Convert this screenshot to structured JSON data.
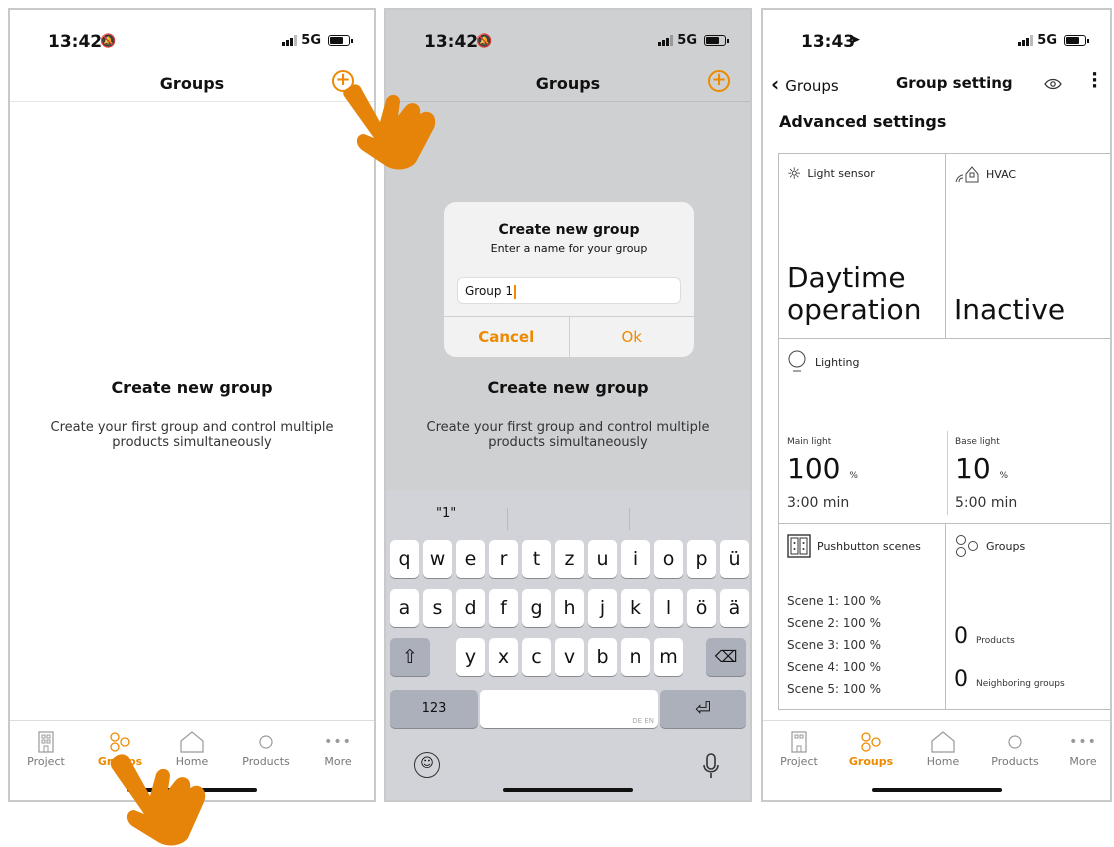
{
  "status": {
    "time_1": "13:42",
    "time_2": "13:42",
    "time_3": "13:43",
    "network": "5G"
  },
  "screen1": {
    "title": "Groups",
    "empty_title": "Create new group",
    "empty_text": "Create your first group and control multiple products simultaneously"
  },
  "screen2": {
    "title": "Groups",
    "dialog": {
      "title": "Create new group",
      "subtitle": "Enter a name for your group",
      "input_value": "Group 1",
      "cancel_label": "Cancel",
      "ok_label": "Ok"
    },
    "empty_title": "Create new group",
    "empty_text": "Create your first group and control multiple products simultaneously",
    "keyboard": {
      "suggestion": "\"1\"",
      "row1": [
        "q",
        "w",
        "e",
        "r",
        "t",
        "z",
        "u",
        "i",
        "o",
        "p",
        "ü"
      ],
      "row2": [
        "a",
        "s",
        "d",
        "f",
        "g",
        "h",
        "j",
        "k",
        "l",
        "ö",
        "ä"
      ],
      "row3": [
        "y",
        "x",
        "c",
        "v",
        "b",
        "n",
        "m"
      ],
      "numbers_label": "123",
      "space_hint": "DE EN"
    }
  },
  "screen3": {
    "back_label": "Groups",
    "title": "Group setting",
    "section": "Advanced settings",
    "light_sensor": {
      "label": "Light sensor",
      "value": "Daytime operation"
    },
    "hvac": {
      "label": "HVAC",
      "value": "Inactive"
    },
    "lighting": {
      "label": "Lighting",
      "main_label": "Main light",
      "main_value": "100",
      "main_unit": "%",
      "main_time": "3:00 min",
      "base_label": "Base light",
      "base_value": "10",
      "base_unit": "%",
      "base_time": "5:00 min"
    },
    "pushbutton": {
      "label": "Pushbutton scenes",
      "scenes": [
        "Scene 1: 100 %",
        "Scene 2: 100 %",
        "Scene 3: 100 %",
        "Scene 4: 100 %",
        "Scene 5: 100 %"
      ]
    },
    "groups_card": {
      "label": "Groups",
      "products_value": "0",
      "products_label": "Products",
      "neighbor_value": "0",
      "neighbor_label": "Neighboring groups"
    }
  },
  "tabbar": {
    "items": [
      {
        "label": "Project",
        "icon": "building-icon"
      },
      {
        "label": "Groups",
        "icon": "groups-icon"
      },
      {
        "label": "Home",
        "icon": "home-icon"
      },
      {
        "label": "Products",
        "icon": "products-icon"
      },
      {
        "label": "More",
        "icon": "more-icon"
      }
    ]
  },
  "colors": {
    "accent": "#ee8a00",
    "keyboard_bg": "#d1d3d9",
    "dim_overlay": "#cfd0d2"
  }
}
